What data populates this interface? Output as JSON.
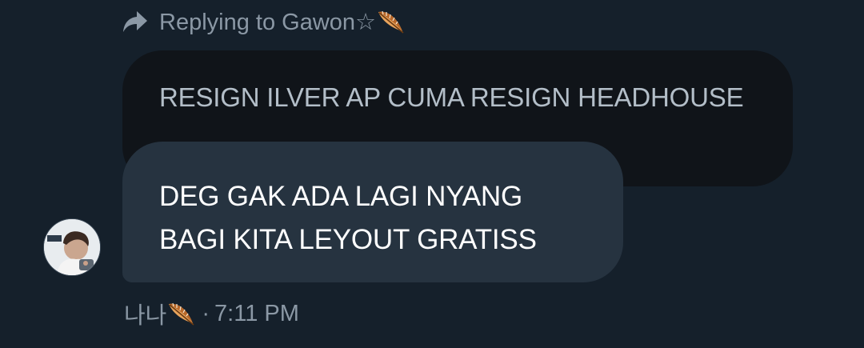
{
  "reply": {
    "label": "Replying to Gawon☆",
    "icon": "reply-arrow-icon"
  },
  "quoted_message": {
    "text": "RESIGN ILVER AP CUMA RESIGN HEADHOUSE"
  },
  "message": {
    "lines": [
      "DEG GAK ADA LAGI NYANG",
      "BAGI KITA LEYOUT GRATISS"
    ]
  },
  "meta": {
    "sender": "나나",
    "separator": "·",
    "time": "7:11 PM"
  },
  "colors": {
    "background": "#15202b",
    "quoted_bubble": "#101419",
    "message_bubble": "#263340",
    "muted_text": "#8b98a5"
  }
}
